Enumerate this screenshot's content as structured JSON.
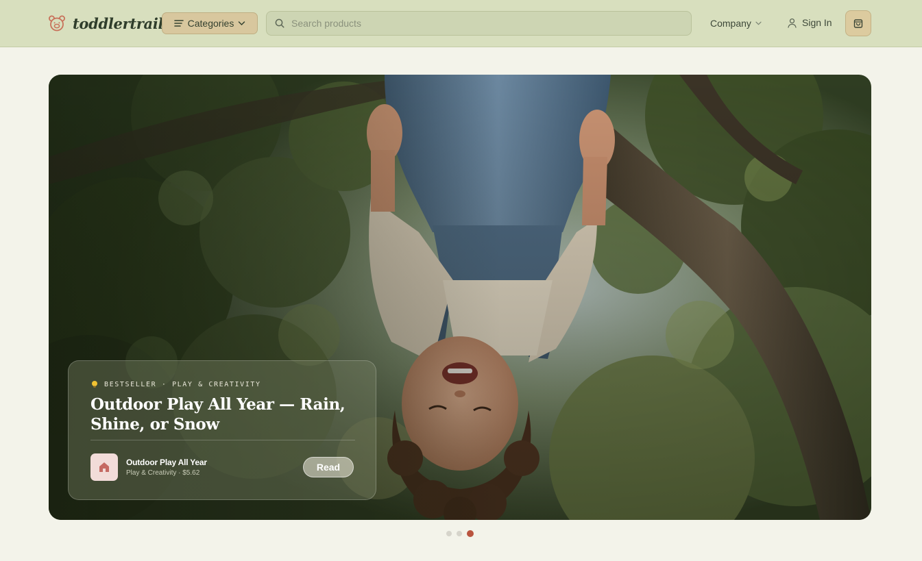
{
  "header": {
    "brand": "toddlertrail",
    "categories_label": "Categories",
    "search_placeholder": "Search products",
    "company_label": "Company",
    "signin_label": "Sign In"
  },
  "hero": {
    "eyebrow": "BESTSELLER · PLAY & CREATIVITY",
    "title": "Outdoor Play All Year — Rain, Shine, or Snow",
    "product": {
      "name": "Outdoor Play All Year",
      "meta": "Play & Creativity · $5.62"
    },
    "read_label": "Read"
  },
  "carousel": {
    "slide_count": 3,
    "active_index": 2
  },
  "colors": {
    "header_bg": "#d8dfbe",
    "page_bg": "#f3f3ea",
    "accent": "#b9543f",
    "button_tan": "#d8c79e"
  },
  "icons": [
    "bear-logo-icon",
    "menu-icon",
    "chevron-down-icon",
    "search-icon",
    "user-icon",
    "shopping-bag-icon",
    "lightbulb-icon",
    "house-icon"
  ]
}
